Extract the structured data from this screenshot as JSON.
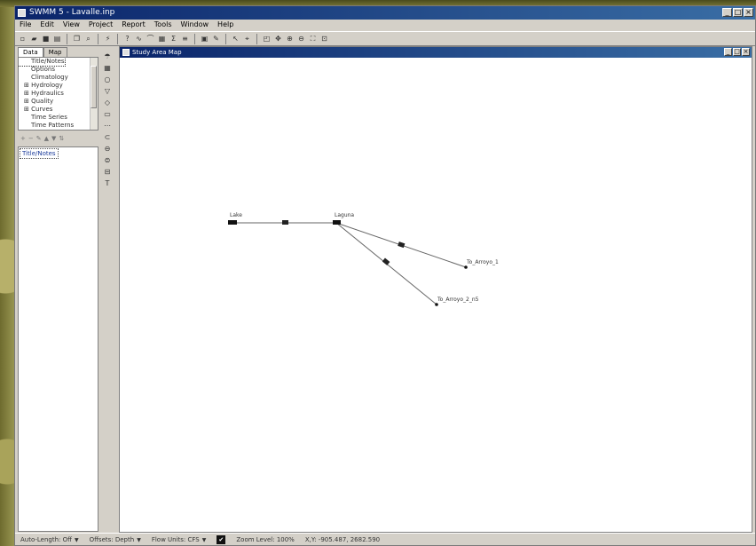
{
  "window": {
    "title": "SWMM 5 - Lavalle.inp",
    "buttons": [
      "_",
      "□",
      "×"
    ]
  },
  "menu": [
    "File",
    "Edit",
    "View",
    "Project",
    "Report",
    "Tools",
    "Window",
    "Help"
  ],
  "browser": {
    "tabs": [
      "Data",
      "Map"
    ],
    "tree": [
      {
        "label": "Title/Notes",
        "expandable": false,
        "selected": true
      },
      {
        "label": "Options",
        "expandable": false
      },
      {
        "label": "Climatology",
        "expandable": false
      },
      {
        "label": "Hydrology",
        "expandable": true
      },
      {
        "label": "Hydraulics",
        "expandable": true
      },
      {
        "label": "Quality",
        "expandable": true
      },
      {
        "label": "Curves",
        "expandable": true
      },
      {
        "label": "Time Series",
        "expandable": false
      },
      {
        "label": "Time Patterns",
        "expandable": false
      }
    ],
    "list_header": "Title/Notes"
  },
  "map_window": {
    "title": "Study Area Map",
    "buttons": [
      "_",
      "□",
      "×"
    ],
    "nodes": [
      {
        "label": "Lake"
      },
      {
        "label": "Laguna"
      },
      {
        "label": "To_Arroyo_1"
      },
      {
        "label": "To_Arroyo_2_n5"
      }
    ]
  },
  "statusbar": {
    "auto_length": "Auto-Length: Off",
    "offsets": "Offsets: Depth",
    "flow_units": "Flow Units: CFS",
    "zoom": "Zoom Level: 100%",
    "coords": "X,Y: -905.487, 2682.590"
  }
}
